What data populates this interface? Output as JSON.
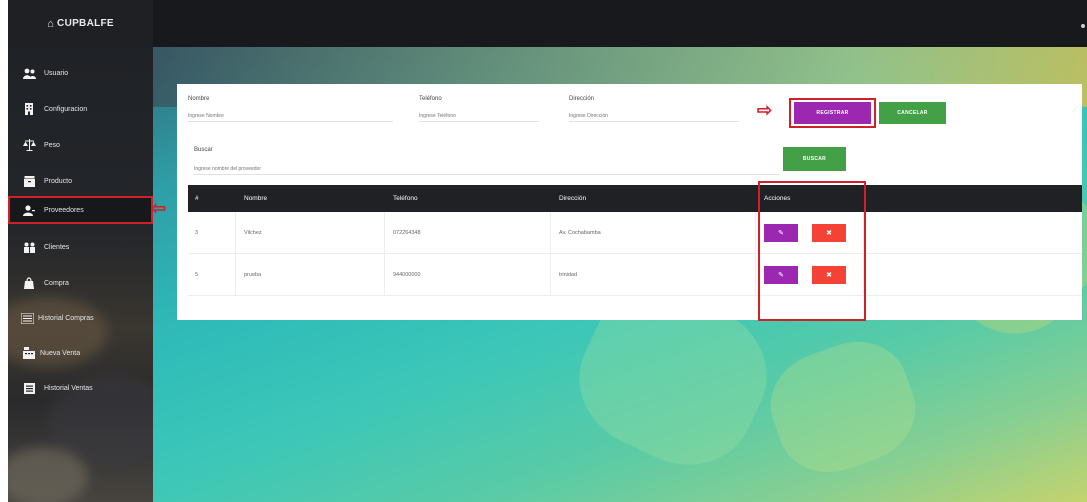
{
  "app": {
    "brand": "CUPBALFE"
  },
  "sidebar": {
    "items": [
      {
        "label": "Usuario",
        "icon": "users-icon"
      },
      {
        "label": "Configuracion",
        "icon": "building-icon"
      },
      {
        "label": "Peso",
        "icon": "scale-icon"
      },
      {
        "label": "Producto",
        "icon": "box-icon"
      },
      {
        "label": "Proveedores",
        "icon": "user-tie-icon",
        "active": true
      },
      {
        "label": "Clientes",
        "icon": "people-icon"
      },
      {
        "label": "Compra",
        "icon": "bag-icon"
      },
      {
        "label": "Historial Compras",
        "icon": "list-icon"
      },
      {
        "label": "Nueva Venta",
        "icon": "cash-register-icon"
      },
      {
        "label": "Historial Ventas",
        "icon": "register-icon"
      }
    ]
  },
  "form": {
    "nombre_label": "Nombre",
    "nombre_placeholder": "Ingrese Nombre",
    "telefono_label": "Teléfono",
    "telefono_placeholder": "Ingrese Teléfono",
    "direccion_label": "Dirección",
    "direccion_placeholder": "Ingrese Dirección",
    "registrar_label": "REGISTRAR",
    "cancelar_label": "CANCELAR",
    "buscar_label": "Buscar",
    "buscar_placeholder": "Ingrese nombre del proveedor",
    "buscar_button": "BUSCAR"
  },
  "table": {
    "headers": [
      "#",
      "Nombre",
      "Teléfono",
      "Dirección",
      "Acciones"
    ],
    "rows": [
      {
        "id": "3",
        "nombre": "Vilchez",
        "telefono": "072264348",
        "direccion": "Av. Cochabamba"
      },
      {
        "id": "5",
        "nombre": "prueba",
        "telefono": "944000000",
        "direccion": "trinidad"
      }
    ],
    "edit_glyph": "✎",
    "delete_glyph": "✖"
  },
  "colors": {
    "accent_purple": "#9c27b0",
    "accent_green": "#43a047",
    "danger": "#f44336",
    "highlight": "#d0202a"
  }
}
